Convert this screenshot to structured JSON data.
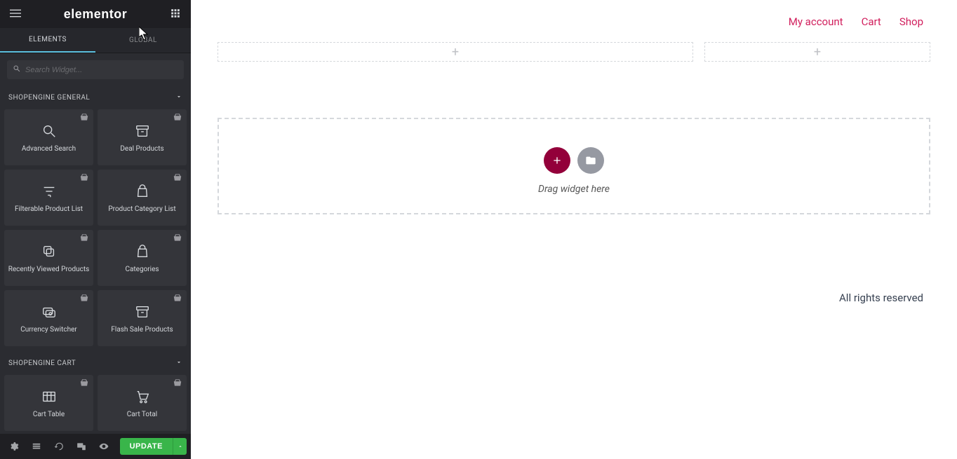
{
  "brand": "elementor",
  "tabs": {
    "elements": "ELEMENTS",
    "global": "GLOBAL"
  },
  "search": {
    "placeholder": "Search Widget..."
  },
  "sections": {
    "general": {
      "title": "SHOPENGINE GENERAL",
      "widgets": [
        {
          "label": "Advanced Search",
          "icon": "search"
        },
        {
          "label": "Deal Products",
          "icon": "archive"
        },
        {
          "label": "Filterable Product List",
          "icon": "filter"
        },
        {
          "label": "Product Category List",
          "icon": "bag"
        },
        {
          "label": "Recently Viewed Products",
          "icon": "copy"
        },
        {
          "label": "Categories",
          "icon": "bag"
        },
        {
          "label": "Currency Switcher",
          "icon": "currency"
        },
        {
          "label": "Flash Sale Products",
          "icon": "archive"
        }
      ]
    },
    "cart": {
      "title": "SHOPENGINE CART",
      "widgets": [
        {
          "label": "Cart Table",
          "icon": "table"
        },
        {
          "label": "Cart Total",
          "icon": "cart"
        }
      ]
    }
  },
  "footer": {
    "update": "UPDATE"
  },
  "nav": {
    "account": "My account",
    "cart": "Cart",
    "shop": "Shop"
  },
  "dropzone": {
    "hint": "Drag widget here"
  },
  "pagefooter": "All rights reserved"
}
